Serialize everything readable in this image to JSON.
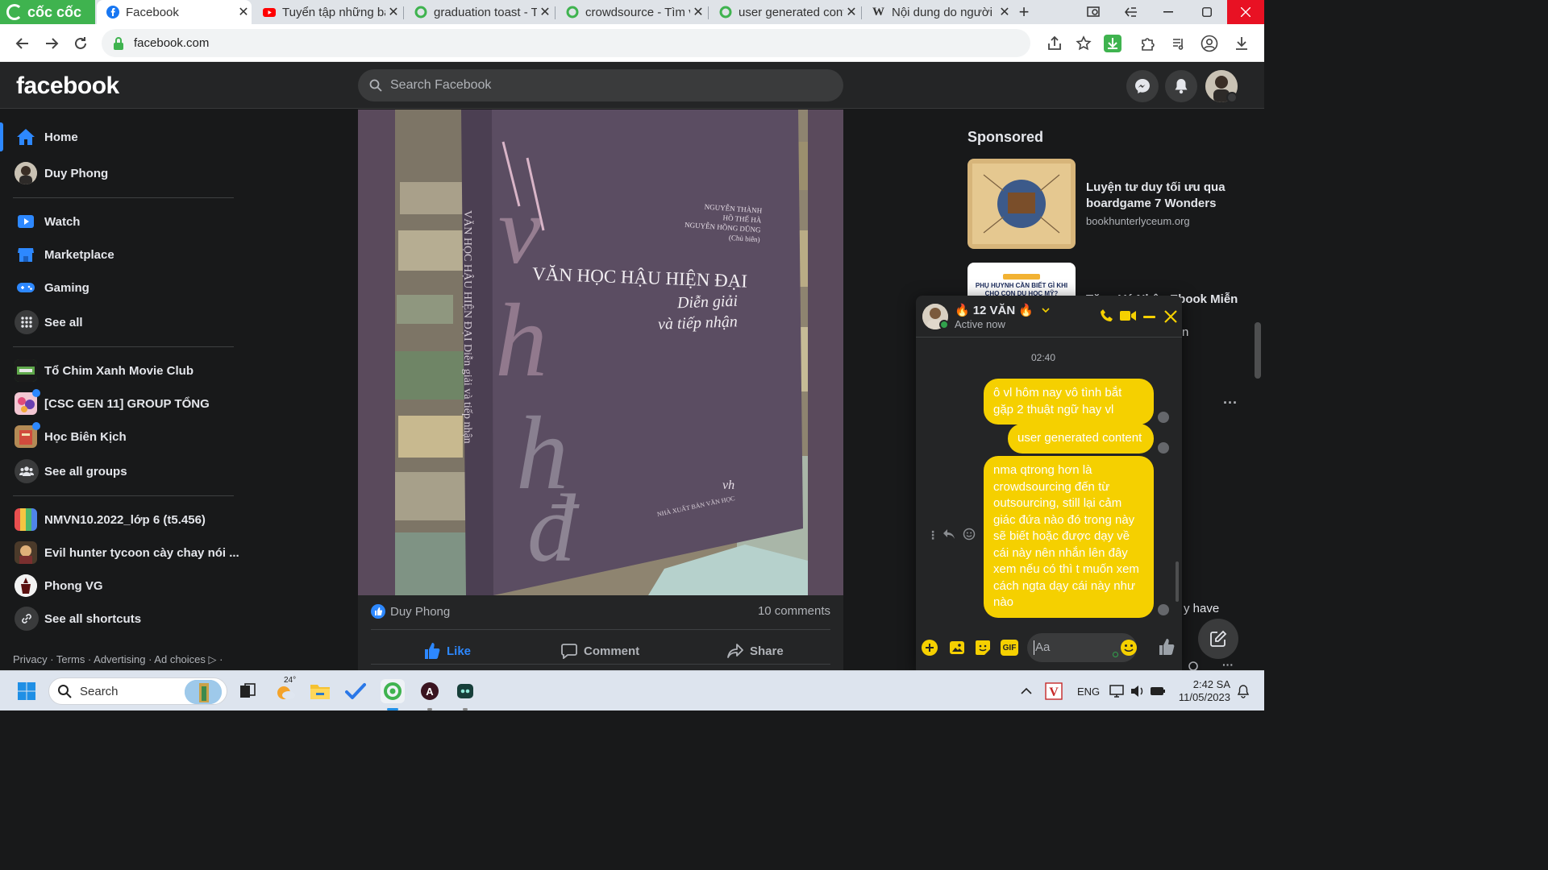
{
  "browser": {
    "brand_label": "cốc cốc",
    "tabs": [
      {
        "title": "Facebook",
        "icon": "facebook-icon",
        "active": true
      },
      {
        "title": "Tuyển tập những bá",
        "icon": "youtube-icon"
      },
      {
        "title": "graduation toast - T",
        "icon": "coccoc-icon"
      },
      {
        "title": "crowdsource - Tìm v",
        "icon": "coccoc-icon"
      },
      {
        "title": "user generated cont",
        "icon": "coccoc-icon"
      },
      {
        "title": "Nội dung do người",
        "icon": "wikipedia-icon"
      }
    ],
    "url": "facebook.com"
  },
  "fb": {
    "logo": "facebook",
    "search_placeholder": "Search Facebook"
  },
  "sidebar": {
    "items": [
      {
        "label": "Home"
      },
      {
        "label": "Duy Phong"
      },
      {
        "label": "Watch"
      },
      {
        "label": "Marketplace"
      },
      {
        "label": "Gaming"
      },
      {
        "label": "See all"
      },
      {
        "label": "Tổ Chim Xanh Movie Club"
      },
      {
        "label": "[CSC GEN 11] GROUP TỔNG"
      },
      {
        "label": "Học Biên Kịch"
      },
      {
        "label": "See all groups"
      },
      {
        "label": "NMVN10.2022_lớp 6 (t5.456)"
      },
      {
        "label": "Evil hunter tycoon cày chay nói ..."
      },
      {
        "label": "Phong VG"
      },
      {
        "label": "See all shortcuts"
      }
    ],
    "footer": "Privacy · Terms · Advertising · Ad choices ▷ ·"
  },
  "post": {
    "book": {
      "authors": [
        "NGUYỄN THÀNH",
        "HỒ THẾ HÀ",
        "NGUYỄN HỒNG DŨNG",
        "(Chủ biên)"
      ],
      "title": "VĂN HỌC HẬU HIỆN ĐẠI",
      "subtitle1": "Diễn giải",
      "subtitle2": "và tiếp nhận",
      "publisher": "NHÀ XUẤT BẢN VĂN HỌC",
      "publisher_mark": "vh",
      "spine": "VĂN HỌC HẬU HIỆN ĐẠI  Diễn giải và tiếp nhận"
    },
    "liker": "Duy Phong",
    "comment_count": "10 comments",
    "actions": {
      "like": "Like",
      "comment": "Comment",
      "share": "Share"
    }
  },
  "right": {
    "sponsored_label": "Sponsored",
    "ads": [
      {
        "title": "Luyện tư duy tối ưu qua boardgame 7 Wonders",
        "url": "bookhunterlyceum.org"
      },
      {
        "title": "Tặng Vé Nhận Ebook Miễn",
        "image_text": "PHỤ HUYNH CẦN BIẾT GÌ KHI CHO CON DU HỌC MỸ?"
      }
    ],
    "peek_text_1": "n",
    "peek_text_2": "y have"
  },
  "chat": {
    "name": "12 VĂN",
    "status": "Active now",
    "timestamp": "02:40",
    "messages": [
      "ô vl hôm nay vô tình bắt gặp 2 thuật ngữ hay vl",
      "user generated content",
      "nma qtrong hơn là crowdsourcing đến từ outsourcing, still lại cảm giác đứa nào đó trong này sẽ biết hoặc được dạy về cái này nên nhắn lên đây xem nếu có thì t muốn xem cách ngta dạy cái này như nào"
    ],
    "input_placeholder": "Aa",
    "accent_color": "#f5d000"
  },
  "taskbar": {
    "search_label": "Search",
    "weather_temp": "24°",
    "lang": "ENG",
    "time": "2:42 SA",
    "date": "11/05/2023"
  }
}
